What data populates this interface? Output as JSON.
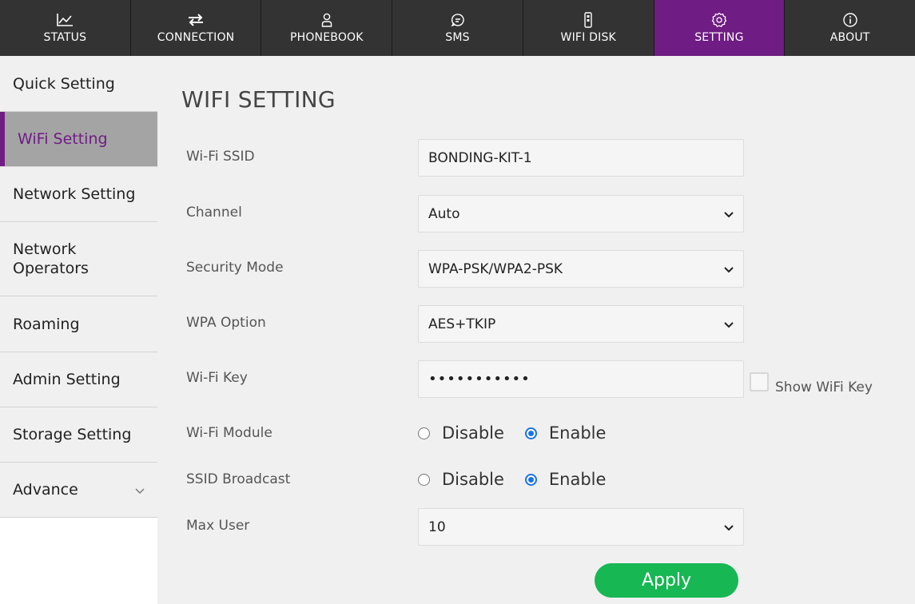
{
  "nav": {
    "tabs": [
      {
        "label": "STATUS",
        "icon": "chart-line-icon"
      },
      {
        "label": "CONNECTION",
        "icon": "swap-arrows-icon"
      },
      {
        "label": "PHONEBOOK",
        "icon": "user-icon"
      },
      {
        "label": "SMS",
        "icon": "chat-bubble-icon"
      },
      {
        "label": "WIFI DISK",
        "icon": "usb-drive-icon"
      },
      {
        "label": "SETTING",
        "icon": "gear-icon",
        "active": true
      },
      {
        "label": "ABOUT",
        "icon": "info-icon"
      }
    ]
  },
  "sidebar": {
    "items": [
      {
        "label": "Quick Setting"
      },
      {
        "label": "WiFi Setting",
        "active": true
      },
      {
        "label": "Network Setting"
      },
      {
        "label": "Network Operators"
      },
      {
        "label": "Roaming"
      },
      {
        "label": "Admin Setting"
      },
      {
        "label": "Storage Setting"
      },
      {
        "label": "Advance",
        "icon": "chevron-down-icon"
      }
    ]
  },
  "main": {
    "title": "WIFI SETTING",
    "ssid": {
      "label": "Wi-Fi SSID",
      "value": "BONDING-KIT-1"
    },
    "channel": {
      "label": "Channel",
      "value": "Auto"
    },
    "security": {
      "label": "Security Mode",
      "value": "WPA-PSK/WPA2-PSK"
    },
    "wpa_option": {
      "label": "WPA Option",
      "value": "AES+TKIP"
    },
    "wifi_key": {
      "label": "Wi-Fi Key",
      "value": "•••••••••••",
      "show_label": "Show WiFi Key",
      "show_checked": false
    },
    "wifi_module": {
      "label": "Wi-Fi Module",
      "disable_label": "Disable",
      "enable_label": "Enable",
      "selected": "Enable"
    },
    "ssid_broadcast": {
      "label": "SSID Broadcast",
      "disable_label": "Disable",
      "enable_label": "Enable",
      "selected": "Enable"
    },
    "max_user": {
      "label": "Max User",
      "value": "10"
    },
    "apply_label": "Apply"
  },
  "colors": {
    "nav_bg": "#333333",
    "accent": "#6f1c84",
    "apply": "#17b754",
    "radio": "#1a73e8"
  }
}
